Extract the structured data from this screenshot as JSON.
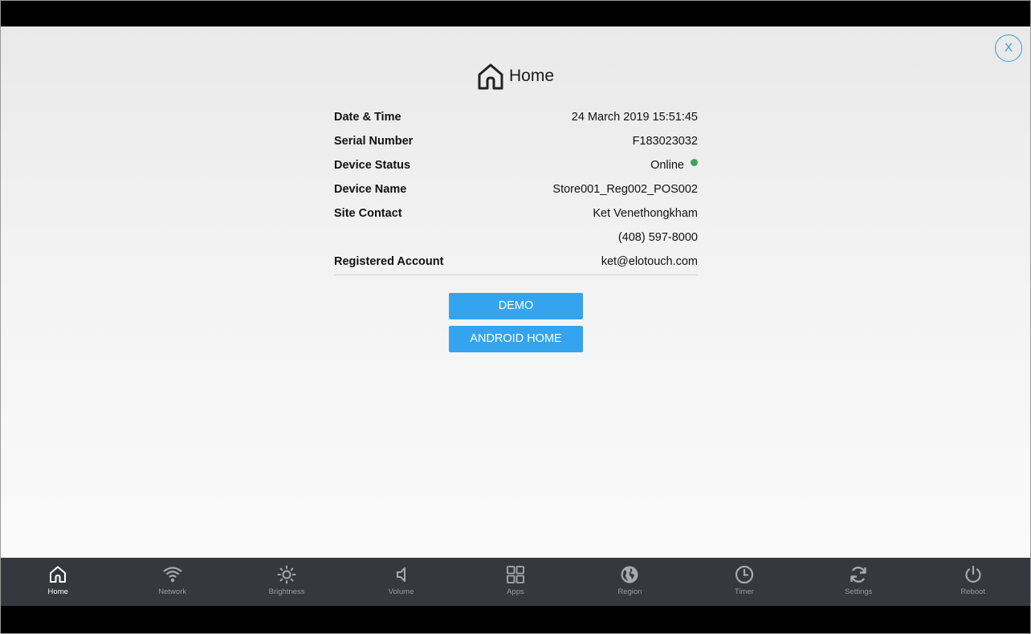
{
  "close_label": "X",
  "page_title": "Home",
  "info": {
    "date_time": {
      "label": "Date & Time",
      "value": "24 March 2019 15:51:45"
    },
    "serial_number": {
      "label": "Serial Number",
      "value": "F183023032"
    },
    "device_status": {
      "label": "Device Status",
      "value": "Online",
      "indicator_color": "#3aa655"
    },
    "device_name": {
      "label": "Device Name",
      "value": "Store001_Reg002_POS002"
    },
    "site_contact": {
      "label": "Site Contact",
      "value": "Ket Venethongkham",
      "phone": "(408) 597-8000"
    },
    "registered_account": {
      "label": "Registered Account",
      "value": "ket@elotouch.com"
    }
  },
  "buttons": {
    "demo": "DEMO",
    "android_home": "ANDROID HOME"
  },
  "colors": {
    "accent": "#34a4ee",
    "nav_bg": "#36383f"
  },
  "nav": {
    "home": {
      "label": "Home",
      "icon": "home-icon"
    },
    "network": {
      "label": "Network",
      "icon": "wifi-icon"
    },
    "brightness": {
      "label": "Brightness",
      "icon": "brightness-icon"
    },
    "volume": {
      "label": "Volume",
      "icon": "volume-icon"
    },
    "apps": {
      "label": "Apps",
      "icon": "apps-icon"
    },
    "region": {
      "label": "Region",
      "icon": "globe-icon"
    },
    "timer": {
      "label": "Timer",
      "icon": "clock-icon"
    },
    "settings": {
      "label": "Settings",
      "icon": "sync-icon"
    },
    "reboot": {
      "label": "Reboot",
      "icon": "power-icon"
    }
  }
}
